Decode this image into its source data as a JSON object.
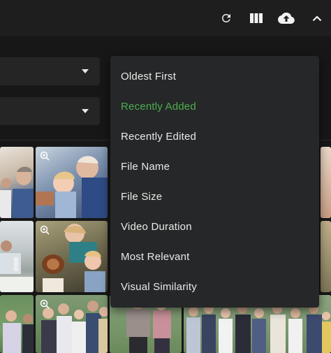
{
  "toolbar": {
    "icons": [
      "refresh-icon",
      "view-columns-icon",
      "upload-icon",
      "chevron-up-icon"
    ]
  },
  "sort_menu": {
    "items": [
      {
        "label": "Oldest First",
        "active": false
      },
      {
        "label": "Recently Added",
        "active": true
      },
      {
        "label": "Recently Edited",
        "active": false
      },
      {
        "label": "File Name",
        "active": false
      },
      {
        "label": "File Size",
        "active": false
      },
      {
        "label": "Video Duration",
        "active": false
      },
      {
        "label": "Most Relevant",
        "active": false
      },
      {
        "label": "Visual Similarity",
        "active": false
      }
    ],
    "active_color": "#4caf50"
  },
  "colors": {
    "background": "#171717",
    "toolbar": "#1e1e1e",
    "menu": "#262728",
    "text": "#eaeaea"
  }
}
